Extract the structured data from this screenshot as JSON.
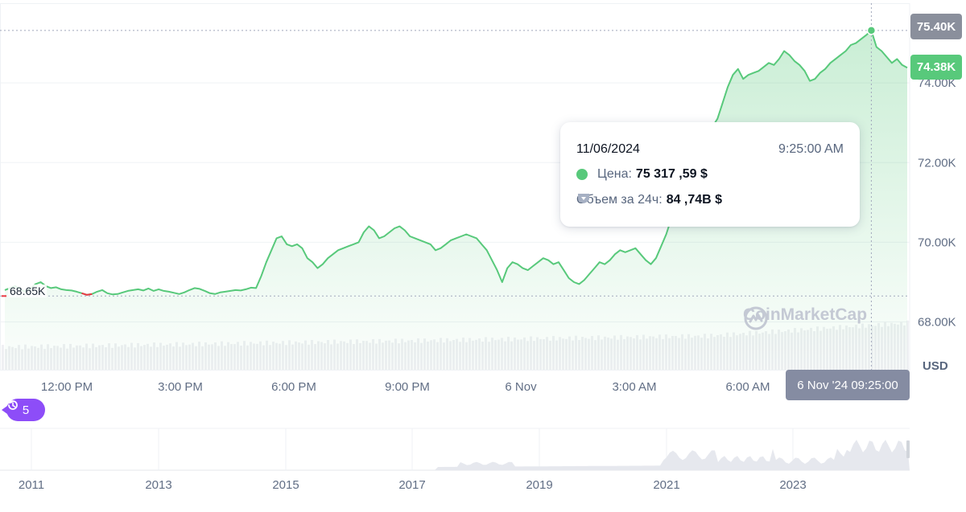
{
  "chart_data": {
    "type": "line",
    "currency_unit": "USD",
    "y_ticks": [
      "68.00K",
      "70.00K",
      "72.00K",
      "74.00K"
    ],
    "ylim": [
      66800,
      76000
    ],
    "x_time_labels": [
      "12:00 PM",
      "3:00 PM",
      "6:00 PM",
      "9:00 PM",
      "6 Nov",
      "3:00 AM",
      "6:00 AM"
    ],
    "start_price_label": "68.65K",
    "high_label": "75.40K",
    "current_label": "74.38K",
    "cursor_time": "6 Nov '24 09:25:00",
    "series": [
      {
        "values": [
          68800,
          68850,
          68900,
          68820,
          68760,
          68830,
          68950,
          69000,
          68900,
          68850,
          68870,
          68820,
          68800,
          68790,
          68760,
          68720,
          68680,
          68700,
          68760,
          68800,
          68720,
          68690,
          68700,
          68740,
          68780,
          68800,
          68820,
          68790,
          68840,
          68780,
          68820,
          68780,
          68760,
          68730,
          68700,
          68740,
          68800,
          68850,
          68830,
          68780,
          68720,
          68700,
          68740,
          68760,
          68780,
          68800,
          68790,
          68820,
          68860,
          68850,
          69150,
          69500,
          69800,
          70100,
          70150,
          69950,
          69900,
          69950,
          69850,
          69600,
          69500,
          69350,
          69450,
          69600,
          69700,
          69800,
          69850,
          69900,
          69950,
          70000,
          70250,
          70400,
          70300,
          70100,
          70150,
          70250,
          70350,
          70400,
          70300,
          70150,
          70100,
          70050,
          70000,
          69950,
          69800,
          69850,
          69950,
          70050,
          70100,
          70150,
          70200,
          70150,
          70100,
          69950,
          69800,
          69550,
          69300,
          69000,
          69350,
          69500,
          69450,
          69350,
          69300,
          69400,
          69500,
          69600,
          69550,
          69450,
          69500,
          69300,
          69100,
          69000,
          68950,
          69050,
          69200,
          69350,
          69500,
          69450,
          69550,
          69700,
          69800,
          69750,
          69800,
          69850,
          69700,
          69550,
          69450,
          69600,
          69900,
          70200,
          70600,
          70950,
          71300,
          71600,
          71800,
          72100,
          72400,
          72700,
          72900,
          73100,
          73500,
          73900,
          74200,
          74350,
          74100,
          74200,
          74250,
          74300,
          74400,
          74500,
          74450,
          74600,
          74800,
          74700,
          74550,
          74450,
          74300,
          74050,
          74100,
          74250,
          74350,
          74500,
          74600,
          74700,
          74800,
          74950,
          75000,
          75100,
          75200,
          75317,
          74900,
          74800,
          74650,
          74500,
          74600,
          74450,
          74380
        ]
      }
    ],
    "tooltip": {
      "date": "11/06/2024",
      "time": "9:25:00 AM",
      "price_label": "Цена:",
      "price_value": "75 317 ,59 $",
      "volume_label": "Объем за 24ч:",
      "volume_value": "84 ,74B $"
    },
    "navigator_years": [
      "2011",
      "2013",
      "2015",
      "2017",
      "2019",
      "2021",
      "2023"
    ]
  },
  "colors": {
    "line_up": "#58c97b",
    "line_down": "#ea3943",
    "area_top": "#58c97b",
    "volume": "#eff0f3",
    "grid": "#eff2f5",
    "history_badge": "#8d4df8"
  },
  "watermark": "CoinMarketCap",
  "history": {
    "count": "5"
  }
}
